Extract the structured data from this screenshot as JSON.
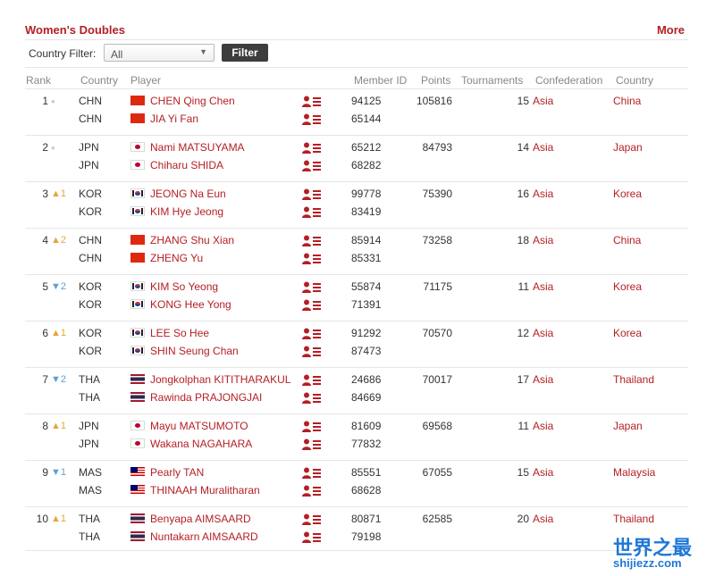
{
  "header": {
    "title": "Women's Doubles",
    "more_label": "More"
  },
  "filter": {
    "label": "Country Filter:",
    "selected": "All",
    "button_label": "Filter"
  },
  "columns": {
    "rank": "Rank",
    "country": "Country",
    "player": "Player",
    "member_id": "Member ID",
    "points": "Points",
    "tournaments": "Tournaments",
    "confederation": "Confederation",
    "country_name": "Country"
  },
  "icons": {
    "player_info": "player-profile-icon",
    "dropdown": "dropdown-arrow-icon",
    "movement_up": "arrow-up-icon",
    "movement_down": "arrow-down-icon",
    "movement_same": "dot-icon"
  },
  "colors": {
    "accent": "#b41f24",
    "button": "#3d3d3d",
    "up": "#e8a33d",
    "down": "#5a9fd6"
  },
  "rows": [
    {
      "rank": "1",
      "movement": {
        "dir": "same",
        "text": "●"
      },
      "points": "105816",
      "tournaments": "15",
      "confederation": "Asia",
      "country_name": "China",
      "players": [
        {
          "cc": "CHN",
          "flag": "chn",
          "name": "CHEN Qing Chen",
          "member_id": "94125"
        },
        {
          "cc": "CHN",
          "flag": "chn",
          "name": "JIA Yi Fan",
          "member_id": "65144"
        }
      ]
    },
    {
      "rank": "2",
      "movement": {
        "dir": "same",
        "text": "●"
      },
      "points": "84793",
      "tournaments": "14",
      "confederation": "Asia",
      "country_name": "Japan",
      "players": [
        {
          "cc": "JPN",
          "flag": "jpn",
          "name": "Nami MATSUYAMA",
          "member_id": "65212"
        },
        {
          "cc": "JPN",
          "flag": "jpn",
          "name": "Chiharu SHIDA",
          "member_id": "68282"
        }
      ]
    },
    {
      "rank": "3",
      "movement": {
        "dir": "up",
        "text": "▲1"
      },
      "points": "75390",
      "tournaments": "16",
      "confederation": "Asia",
      "country_name": "Korea",
      "players": [
        {
          "cc": "KOR",
          "flag": "kor",
          "name": "JEONG Na Eun",
          "member_id": "99778"
        },
        {
          "cc": "KOR",
          "flag": "kor",
          "name": "KIM Hye Jeong",
          "member_id": "83419"
        }
      ]
    },
    {
      "rank": "4",
      "movement": {
        "dir": "up",
        "text": "▲2"
      },
      "points": "73258",
      "tournaments": "18",
      "confederation": "Asia",
      "country_name": "China",
      "players": [
        {
          "cc": "CHN",
          "flag": "chn",
          "name": "ZHANG Shu Xian",
          "member_id": "85914"
        },
        {
          "cc": "CHN",
          "flag": "chn",
          "name": "ZHENG Yu",
          "member_id": "85331"
        }
      ]
    },
    {
      "rank": "5",
      "movement": {
        "dir": "down",
        "text": "▼2"
      },
      "points": "71175",
      "tournaments": "11",
      "confederation": "Asia",
      "country_name": "Korea",
      "players": [
        {
          "cc": "KOR",
          "flag": "kor",
          "name": "KIM So Yeong",
          "member_id": "55874"
        },
        {
          "cc": "KOR",
          "flag": "kor",
          "name": "KONG Hee Yong",
          "member_id": "71391"
        }
      ]
    },
    {
      "rank": "6",
      "movement": {
        "dir": "up",
        "text": "▲1"
      },
      "points": "70570",
      "tournaments": "12",
      "confederation": "Asia",
      "country_name": "Korea",
      "players": [
        {
          "cc": "KOR",
          "flag": "kor",
          "name": "LEE So Hee",
          "member_id": "91292"
        },
        {
          "cc": "KOR",
          "flag": "kor",
          "name": "SHIN Seung Chan",
          "member_id": "87473"
        }
      ]
    },
    {
      "rank": "7",
      "movement": {
        "dir": "down",
        "text": "▼2"
      },
      "points": "70017",
      "tournaments": "17",
      "confederation": "Asia",
      "country_name": "Thailand",
      "players": [
        {
          "cc": "THA",
          "flag": "tha",
          "name": "Jongkolphan KITITHARAKUL",
          "member_id": "24686"
        },
        {
          "cc": "THA",
          "flag": "tha",
          "name": "Rawinda PRAJONGJAI",
          "member_id": "84669"
        }
      ]
    },
    {
      "rank": "8",
      "movement": {
        "dir": "up",
        "text": "▲1"
      },
      "points": "69568",
      "tournaments": "11",
      "confederation": "Asia",
      "country_name": "Japan",
      "players": [
        {
          "cc": "JPN",
          "flag": "jpn",
          "name": "Mayu MATSUMOTO",
          "member_id": "81609"
        },
        {
          "cc": "JPN",
          "flag": "jpn",
          "name": "Wakana NAGAHARA",
          "member_id": "77832"
        }
      ]
    },
    {
      "rank": "9",
      "movement": {
        "dir": "down",
        "text": "▼1"
      },
      "points": "67055",
      "tournaments": "15",
      "confederation": "Asia",
      "country_name": "Malaysia",
      "players": [
        {
          "cc": "MAS",
          "flag": "mas",
          "name": "Pearly TAN",
          "member_id": "85551"
        },
        {
          "cc": "MAS",
          "flag": "mas",
          "name": "THINAAH Muralitharan",
          "member_id": "68628"
        }
      ]
    },
    {
      "rank": "10",
      "movement": {
        "dir": "up",
        "text": "▲1"
      },
      "points": "62585",
      "tournaments": "20",
      "confederation": "Asia",
      "country_name": "Thailand",
      "players": [
        {
          "cc": "THA",
          "flag": "tha",
          "name": "Benyapa AIMSAARD",
          "member_id": "80871"
        },
        {
          "cc": "THA",
          "flag": "tha",
          "name": "Nuntakarn AIMSAARD",
          "member_id": "79198"
        }
      ]
    }
  ],
  "watermark": {
    "cn": "世界之最",
    "en": "shijiezz.com"
  }
}
